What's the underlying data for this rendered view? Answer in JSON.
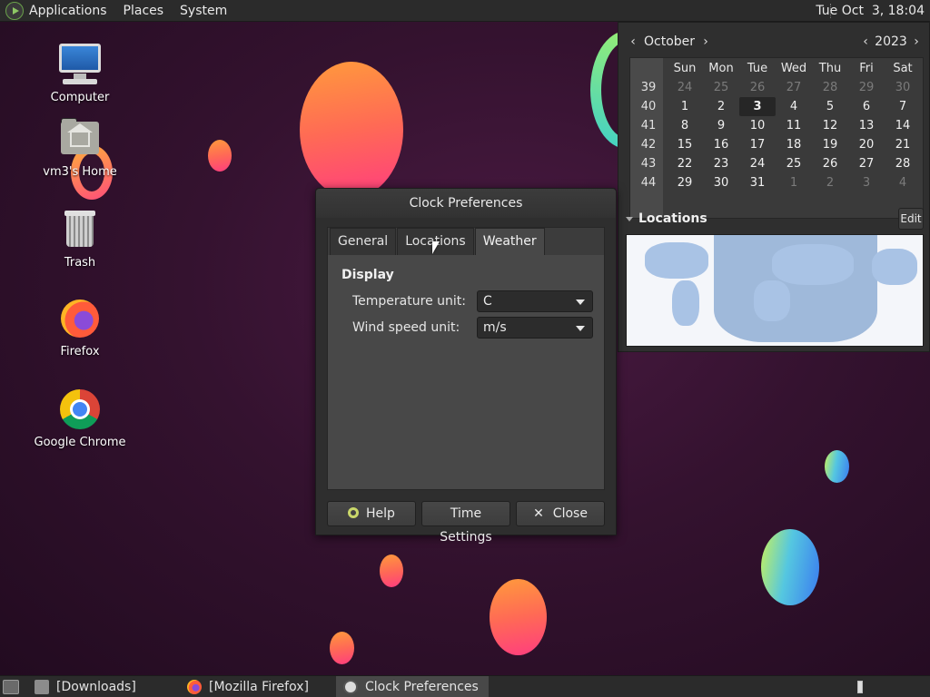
{
  "top_panel": {
    "menus": [
      "Applications",
      "Places",
      "System"
    ],
    "clock": "Tue Oct  3, 18:04"
  },
  "desktop_icons": [
    {
      "label": "Computer",
      "icon": "computer-icon"
    },
    {
      "label": "vm3's Home",
      "icon": "home-folder-icon"
    },
    {
      "label": "Trash",
      "icon": "trash-icon"
    },
    {
      "label": "Firefox",
      "icon": "firefox-icon"
    },
    {
      "label": "Google Chrome",
      "icon": "chrome-icon"
    }
  ],
  "calendar": {
    "month": "October",
    "year": "2023",
    "weekday_headers": [
      "Sun",
      "Mon",
      "Tue",
      "Wed",
      "Thu",
      "Fri",
      "Sat"
    ],
    "weeks": [
      {
        "num": "39",
        "days": [
          "24",
          "25",
          "26",
          "27",
          "28",
          "29",
          "30"
        ]
      },
      {
        "num": "40",
        "days": [
          "1",
          "2",
          "3",
          "4",
          "5",
          "6",
          "7"
        ]
      },
      {
        "num": "41",
        "days": [
          "8",
          "9",
          "10",
          "11",
          "12",
          "13",
          "14"
        ]
      },
      {
        "num": "42",
        "days": [
          "15",
          "16",
          "17",
          "18",
          "19",
          "20",
          "21"
        ]
      },
      {
        "num": "43",
        "days": [
          "22",
          "23",
          "24",
          "25",
          "26",
          "27",
          "28"
        ]
      },
      {
        "num": "44",
        "days": [
          "29",
          "30",
          "31",
          "1",
          "2",
          "3",
          "4"
        ]
      }
    ],
    "today": "3",
    "locations_title": "Locations",
    "edit_label": "Edit"
  },
  "dialog": {
    "title": "Clock Preferences",
    "tabs": [
      {
        "label": "General",
        "active": false
      },
      {
        "label": "Locations",
        "active": false
      },
      {
        "label": "Weather",
        "active": true
      }
    ],
    "section_title": "Display",
    "fields": [
      {
        "label": "Temperature unit:",
        "value": "C"
      },
      {
        "label": "Wind speed unit:",
        "value": "m/s"
      }
    ],
    "buttons": {
      "help": "Help",
      "time_settings": "Time Settings",
      "close": "Close"
    }
  },
  "taskbar": {
    "tasks": [
      {
        "label": "[Downloads]",
        "active": false
      },
      {
        "label": "[Mozilla Firefox]",
        "active": false
      },
      {
        "label": "Clock Preferences",
        "active": true
      }
    ]
  },
  "colors": {
    "panel_bg": "#2b2b2b",
    "dialog_bg": "#2e2e2e",
    "desktop_bg": "#34122f",
    "accent_orange": "#ff7a4a",
    "accent_blue": "#3a7bf0"
  }
}
